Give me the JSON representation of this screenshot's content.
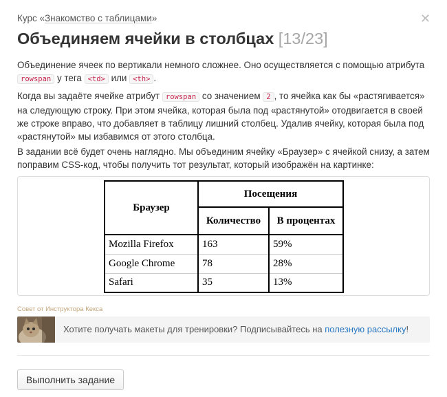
{
  "breadcrumb": {
    "prefix": "Курс «",
    "course_link": "Знакомство с таблицами",
    "suffix": "»"
  },
  "title": "Объединяем ячейки в столбцах",
  "progress": "[13/23]",
  "close_icon": "close-icon",
  "paragraph1": {
    "t1": "Объединение ячеек по вертикали немного сложнее. Оно осуществляется с помощью атрибута ",
    "code1": "rowspan",
    "t2": " у тега ",
    "code2": "<td>",
    "t3": " или ",
    "code3": "<th>",
    "t4": "."
  },
  "paragraph2": {
    "t1": "Когда вы задаёте ячейке атрибут ",
    "code1": "rowspan",
    "t2": " со значением ",
    "code2": "2",
    "t3": ", то ячейка как бы «растягивается» на следующую строку. При этом ячейка, которая была под «растянутой» отодвигается в своей же строке вправо, что добавляет в таблицу лишний столбец. Удалив ячейку, которая была под «растянутой» мы избавимся от этого столбца."
  },
  "paragraph3": "В задании всё будет очень наглядно. Мы объединим ячейку «Браузер» с ячейкой снизу, а затем поправим CSS-код, чтобы получить тот результат, который изображён на картинке:",
  "demo_table": {
    "header_browser": "Браузер",
    "header_visits": "Посещения",
    "header_count": "Количество",
    "header_percent": "В процентах",
    "rows": [
      {
        "browser": "Mozilla Firefox",
        "count": "163",
        "percent": "59%"
      },
      {
        "browser": "Google Chrome",
        "count": "78",
        "percent": "28%"
      },
      {
        "browser": "Safari",
        "count": "35",
        "percent": "13%"
      }
    ]
  },
  "tip": {
    "title": "Совет от Инструктора Кекса",
    "text": "Хотите получать макеты для тренировки? Подписывайтесь на ",
    "link": "полезную рассылку",
    "suffix": "!",
    "avatar_icon": "cat-avatar"
  },
  "submit_button": "Выполнить задание",
  "colors": {
    "code_text": "#c7254e",
    "link": "#2a78c2",
    "tip_title": "#c2a47a"
  }
}
